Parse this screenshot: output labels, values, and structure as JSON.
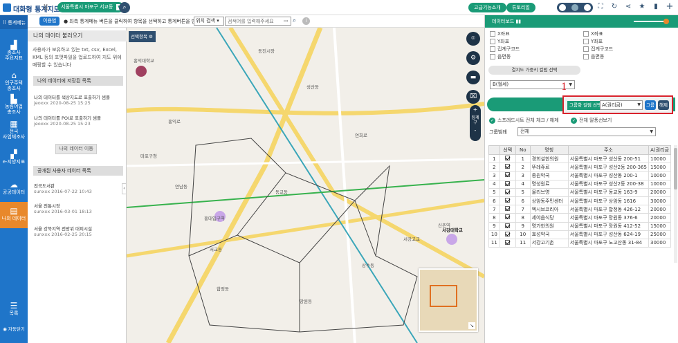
{
  "app": {
    "title": "대화형 통계지도",
    "region": "서울특별시 마포구 서교동",
    "top_buttons": [
      "고급기능소개",
      "튜토리얼"
    ]
  },
  "rail": {
    "menu": "통계메뉴",
    "items": [
      {
        "label1": "총조사",
        "label2": "주요지표"
      },
      {
        "label1": "인구주택",
        "label2": "총조사"
      },
      {
        "label1": "농림어업",
        "label2": "총조사"
      },
      {
        "label1": "전국",
        "label2": "사업체조사"
      },
      {
        "label1": "e-지방지표",
        "label2": ""
      },
      {
        "label1": "공공데이터",
        "label2": ""
      },
      {
        "label1": "나의 데이터",
        "label2": ""
      }
    ],
    "bottom_menu": "목록",
    "auto_close": "자동닫기"
  },
  "subbar": {
    "usage": "이용법",
    "hint": "좌측 통계메뉴 버튼을 클릭하여 항목을 선택하고 통계버튼을 만드세요.",
    "position_search": "위치 검색",
    "address_placeholder": "검색어를 입력해주세요"
  },
  "left_panel": {
    "title": "나의 데이터 불러오기",
    "description": "사용자가 보유하고 있는 txt, csv, Excel, KML 등의 포맷파일을 업로드하여 지도 위에 매핑할 수 있습니다",
    "saved_section": "나의 데이터에 저장된 목록",
    "saved": [
      {
        "name": "나의 데이터를 색상지도로 표출하기 샘플",
        "meta": "jeoxxx 2020-08-25 15:25"
      },
      {
        "name": "나의 데이터를 POI로 표출하기 샘플",
        "meta": "jeoxxx 2020-08-25 15:23"
      }
    ],
    "move_button": "나의 데이터 이동",
    "public_section": "공개된 사용자 데이터 목록",
    "public": [
      {
        "name": "전국도서관",
        "meta": "sunxxx 2016-07-22 10:43"
      },
      {
        "name": "서울 전통시장",
        "meta": "sunxxx 2016-03-01 18:13"
      },
      {
        "name": "서울 강북지역 전방위 대피시설",
        "meta": "sunxxx 2016-02-25 20:15"
      }
    ]
  },
  "map": {
    "select_area": "선택항목",
    "zoom_labels": [
      "+",
      "집계구",
      "-"
    ],
    "labels": [
      "홍익대학교",
      "홍대입구역",
      "동교동",
      "연남동",
      "서교동",
      "합정동",
      "망원동",
      "상수동",
      "마포구청",
      "성산동",
      "신촌역",
      "서강대학교",
      "동진시장",
      "서강고교",
      "연희로",
      "홍익로"
    ]
  },
  "right_panel": {
    "header": "데이터보드",
    "left_fields": [
      "X좌표",
      "Y좌표",
      "집계구코드",
      "읍면동"
    ],
    "right_fields": [
      "X좌표",
      "Y좌표",
      "집계구코드",
      "읍면동"
    ],
    "key_column_button": "결지도 가중키 컬럼 선택",
    "key_column_value": "B(월세)",
    "annotation": "1",
    "join_label": "그룹화 컬럼 선택",
    "join_value": "A(권리금)",
    "join_btn": "그룹",
    "release_btn": "해제",
    "check_all": "스프레드시트 전체 체크 / 해제",
    "show_all": "전체 말풍선보기",
    "group_label": "그룹범례",
    "group_value": "전체",
    "table": {
      "headers": [
        "",
        "선택",
        "No",
        "명칭",
        "주소",
        "A(권리금"
      ],
      "rows": [
        [
          "1",
          "1",
          "경희설한의원",
          "서울특별시 마포구 성산동 200-51",
          "10000"
        ],
        [
          "2",
          "2",
          "뚜레쥬르",
          "서울특별시 마포구 성산2동 200-365",
          "15000"
        ],
        [
          "3",
          "3",
          "종원약국",
          "서울특별시 마포구 성산동 200-1",
          "10000"
        ],
        [
          "4",
          "4",
          "명성원료",
          "서울특별시 마포구 성산2동 200-38",
          "10000"
        ],
        [
          "5",
          "5",
          "올리브영",
          "서울특별시 마포구 동교동 163-9",
          "20000"
        ],
        [
          "6",
          "6",
          "상암동주민센터",
          "서울특별시 마포구 상암동 1616",
          "30000"
        ],
        [
          "7",
          "7",
          "엑시브코리아",
          "서울특별시 마포구 합정동 426-12",
          "20000"
        ],
        [
          "8",
          "8",
          "세야음식당",
          "서울특별시 마포구 망원동 376-6",
          "20000"
        ],
        [
          "9",
          "9",
          "명가한의원",
          "서울특별시 마포구 망원동 412-52",
          "15000"
        ],
        [
          "10",
          "10",
          "효성약국",
          "서울특별시 마포구 성산동 624-19",
          "25000"
        ],
        [
          "11",
          "11",
          "서강고기촌",
          "서울특별시 마포구 노고산동 31-84",
          "30000"
        ]
      ]
    }
  }
}
